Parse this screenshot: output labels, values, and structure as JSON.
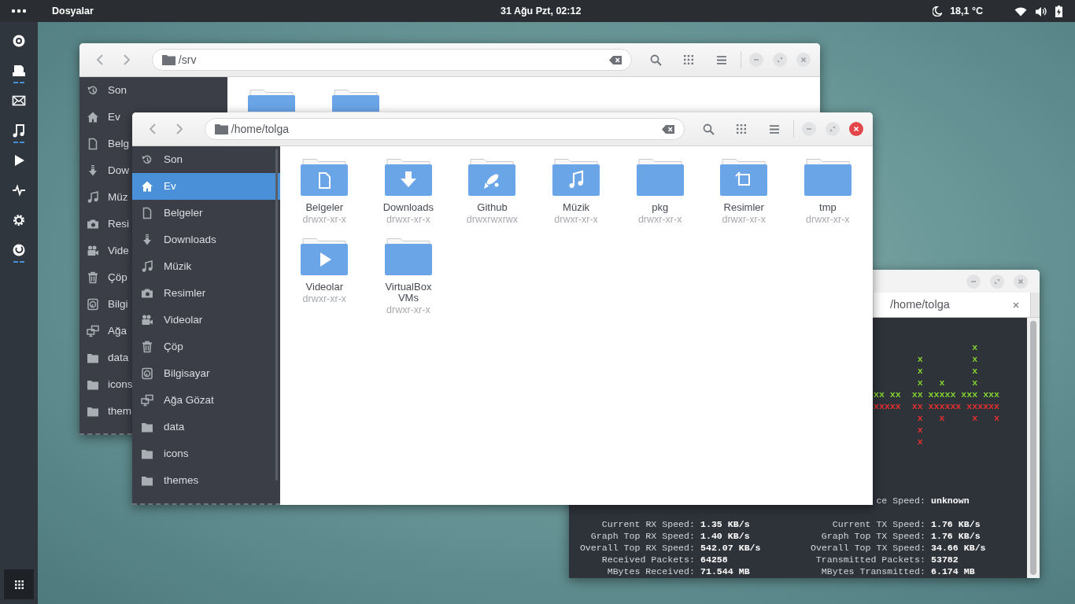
{
  "top_bar": {
    "app_menu": "Dosyalar",
    "clock": "31 Ağu Pzt, 02:12",
    "temperature": "18,1 °C"
  },
  "dock": {
    "items": [
      {
        "kind": "browser",
        "running": false
      },
      {
        "kind": "files",
        "running": true
      },
      {
        "kind": "mail",
        "running": false
      },
      {
        "kind": "music",
        "running": true
      },
      {
        "kind": "video",
        "running": false
      },
      {
        "kind": "monitor",
        "running": false
      },
      {
        "kind": "settings",
        "running": false
      },
      {
        "kind": "firefox",
        "running": true
      }
    ]
  },
  "back_window": {
    "focused": false,
    "path": "/srv",
    "sidebar": [
      {
        "kind": "recent",
        "label": "Son",
        "selected": false
      },
      {
        "kind": "home",
        "label": "Ev",
        "selected": false
      },
      {
        "kind": "documents",
        "label": "Belg",
        "selected": false
      },
      {
        "kind": "downloads",
        "label": "Dow",
        "selected": false
      },
      {
        "kind": "music",
        "label": "Müz",
        "selected": false
      },
      {
        "kind": "pictures",
        "label": "Resi",
        "selected": false
      },
      {
        "kind": "videos",
        "label": "Vide",
        "selected": false
      },
      {
        "kind": "trash",
        "label": "Çöp",
        "selected": false
      },
      {
        "kind": "computer",
        "label": "Bilgi",
        "selected": false
      },
      {
        "kind": "network",
        "label": "Ağa",
        "selected": false
      },
      {
        "kind": "folder",
        "label": "data",
        "selected": false
      },
      {
        "kind": "folder",
        "label": "icons",
        "selected": false
      },
      {
        "kind": "folder",
        "label": "them",
        "selected": false
      }
    ],
    "folders": [
      {
        "kind": "plain"
      },
      {
        "kind": "plain"
      }
    ]
  },
  "terminal_window": {
    "focused": false,
    "tab_title": "/home/tolga",
    "graph_rows": [
      {
        "text": "                  x",
        "color": "#84d52f"
      },
      {
        "text": "        x         x",
        "color": "#84d52f"
      },
      {
        "text": "        x         x",
        "color": "#84d52f"
      },
      {
        "text": "        x   x     x",
        "color": "#84d52f"
      },
      {
        "text": "xx xx  xx xxxxx xxx xxx",
        "color": "#84d52f"
      },
      {
        "text": "xxxxx  xx xxxxxx xxxxxx",
        "color": "#e8302f"
      },
      {
        "text": "        x   x     x   x",
        "color": "#e8302f"
      },
      {
        "text": "        x",
        "color": "#e8302f"
      },
      {
        "text": "        x",
        "color": "#e8302f"
      }
    ],
    "interface_line": {
      "label": "ce Speed:",
      "value": "unknown"
    },
    "stats": [
      {
        "left": {
          "label": "Current RX Speed:",
          "value": "1.35 KB/s"
        },
        "right": {
          "label": "Current TX Speed:",
          "value": "1.76 KB/s"
        }
      },
      {
        "left": {
          "label": "Graph Top RX Speed:",
          "value": "1.40 KB/s"
        },
        "right": {
          "label": "Graph Top TX Speed:",
          "value": "1.76 KB/s"
        }
      },
      {
        "left": {
          "label": "Overall Top RX Speed:",
          "value": "542.07 KB/s"
        },
        "right": {
          "label": "Overall Top TX Speed:",
          "value": "34.66 KB/s"
        }
      },
      {
        "left": {
          "label": "Received Packets:",
          "value": "64258"
        },
        "right": {
          "label": "Transmitted Packets:",
          "value": "53782"
        }
      },
      {
        "left": {
          "label": "MBytes Received:",
          "value": "71.544 MB"
        },
        "right": {
          "label": "MBytes Transmitted:",
          "value": "6.174 MB"
        }
      }
    ]
  },
  "front_window": {
    "focused": true,
    "path": "/home/tolga",
    "sidebar": [
      {
        "kind": "recent",
        "label": "Son",
        "selected": false
      },
      {
        "kind": "home",
        "label": "Ev",
        "selected": true
      },
      {
        "kind": "documents",
        "label": "Belgeler",
        "selected": false
      },
      {
        "kind": "downloads",
        "label": "Downloads",
        "selected": false
      },
      {
        "kind": "music",
        "label": "Müzik",
        "selected": false
      },
      {
        "kind": "pictures",
        "label": "Resimler",
        "selected": false
      },
      {
        "kind": "videos",
        "label": "Videolar",
        "selected": false
      },
      {
        "kind": "trash",
        "label": "Çöp",
        "selected": false
      },
      {
        "kind": "computer",
        "label": "Bilgisayar",
        "selected": false
      },
      {
        "kind": "network",
        "label": "Ağa Gözat",
        "selected": false
      },
      {
        "kind": "folder",
        "label": "data",
        "selected": false
      },
      {
        "kind": "folder",
        "label": "icons",
        "selected": false
      },
      {
        "kind": "folder",
        "label": "themes",
        "selected": false
      }
    ],
    "folders": [
      {
        "kind": "document",
        "name": "Belgeler",
        "permissions": "drwxr-xr-x"
      },
      {
        "kind": "download",
        "name": "Downloads",
        "permissions": "drwxr-xr-x"
      },
      {
        "kind": "rocket",
        "name": "Github",
        "permissions": "drwxrwxrwx"
      },
      {
        "kind": "music",
        "name": "Müzik",
        "permissions": "drwxr-xr-x"
      },
      {
        "kind": "plain",
        "name": "pkg",
        "permissions": "drwxr-xr-x"
      },
      {
        "kind": "picture",
        "name": "Resimler",
        "permissions": "drwxr-xr-x"
      },
      {
        "kind": "plain",
        "name": "tmp",
        "permissions": "drwxr-xr-x"
      },
      {
        "kind": "video",
        "name": "Videolar",
        "permissions": "drwxr-xr-x"
      },
      {
        "kind": "plain",
        "name": "VirtualBox VMs",
        "permissions": "drwxr-xr-x"
      }
    ]
  }
}
